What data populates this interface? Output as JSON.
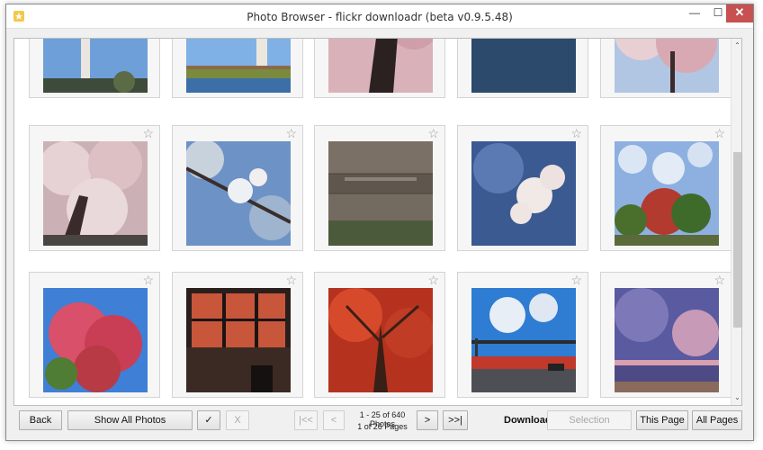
{
  "window": {
    "title": "Photo Browser - flickr downloadr (beta v0.9.5.48)",
    "minimize_glyph": "—",
    "maximize_glyph": "☐",
    "close_glyph": "✕",
    "app_icon": "star-app-icon"
  },
  "gallery": {
    "star_glyph": "☆",
    "tiles": [
      {
        "name": "photo-washington-monument",
        "icon": "photo"
      },
      {
        "name": "photo-monument-tidal-basin",
        "icon": "photo"
      },
      {
        "name": "photo-cherry-trunk",
        "icon": "photo"
      },
      {
        "name": "photo-water-skyline",
        "icon": "photo"
      },
      {
        "name": "photo-cherry-blossoms-sky",
        "icon": "photo"
      },
      {
        "name": "photo-cherry-tree-dense",
        "icon": "photo"
      },
      {
        "name": "photo-blossom-branch",
        "icon": "photo"
      },
      {
        "name": "photo-stone-wall-inscription",
        "icon": "photo"
      },
      {
        "name": "photo-blossom-closeup",
        "icon": "photo"
      },
      {
        "name": "photo-autumn-trees-clouds",
        "icon": "photo"
      },
      {
        "name": "photo-red-maple",
        "icon": "photo"
      },
      {
        "name": "photo-window-autumn",
        "icon": "photo"
      },
      {
        "name": "photo-red-canopy",
        "icon": "photo"
      },
      {
        "name": "photo-street-traffic-light",
        "icon": "photo"
      },
      {
        "name": "photo-sunset-beach",
        "icon": "photo"
      }
    ]
  },
  "scrollbar": {
    "up_glyph": "⌃",
    "down_glyph": "⌄"
  },
  "toolbar": {
    "back_label": "Back",
    "show_all_label": "Show All Photos",
    "check_label": "✓",
    "uncheck_label": "X",
    "first_label": "|<<",
    "prev_label": "<",
    "photos_info": "1 - 25 of 640 Photos",
    "pages_info": "1 of 26 Pages",
    "next_label": ">",
    "last_label": ">>|",
    "download_label": "Download",
    "selection_label": "Selection",
    "this_page_label": "This Page",
    "all_pages_label": "All Pages"
  }
}
